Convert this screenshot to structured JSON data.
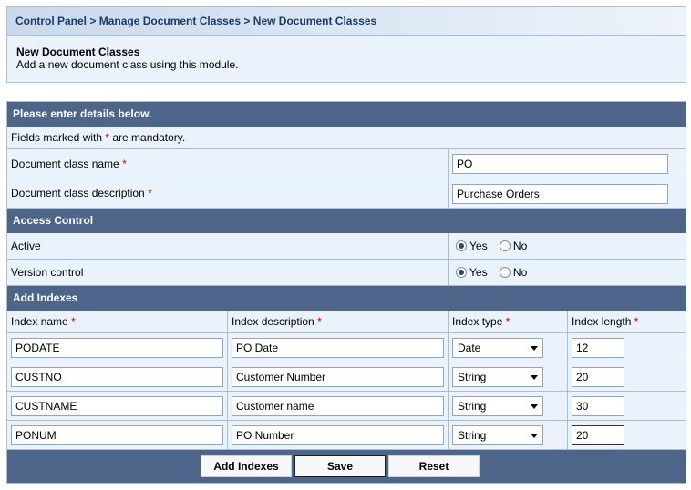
{
  "breadcrumb": {
    "part1": "Control Panel",
    "sep1": " > ",
    "part2": "Manage Document Classes",
    "sep2": " > ",
    "part3": "New Document Classes"
  },
  "page": {
    "title": "New Document Classes",
    "description": "Add a new document class using this module."
  },
  "form": {
    "header": "Please enter details below.",
    "mandatory_note_prefix": "Fields marked with ",
    "mandatory_star": "*",
    "mandatory_note_suffix": " are mandatory.",
    "class_name_label": "Document class name",
    "class_name_value": "PO",
    "class_desc_label": "Document class description",
    "class_desc_value": "Purchase Orders"
  },
  "access": {
    "header": "Access Control",
    "active_label": "Active",
    "version_label": "Version control",
    "yes": "Yes",
    "no": "No",
    "active_selected": "Yes",
    "version_selected": "Yes"
  },
  "indexes": {
    "header": "Add Indexes",
    "col_name": "Index name",
    "col_desc": "Index description",
    "col_type": "Index type",
    "col_length": "Index length",
    "rows": [
      {
        "name": "PODATE",
        "desc": "PO Date",
        "type": "Date",
        "length": "12"
      },
      {
        "name": "CUSTNO",
        "desc": "Customer Number",
        "type": "String",
        "length": "20"
      },
      {
        "name": "CUSTNAME",
        "desc": "Customer name",
        "type": "String",
        "length": "30"
      },
      {
        "name": "PONUM",
        "desc": "PO Number",
        "type": "String",
        "length": "20"
      }
    ]
  },
  "buttons": {
    "add_indexes": "Add Indexes",
    "save": "Save",
    "reset": "Reset"
  },
  "colors": {
    "section_header": "#4d6589",
    "panel_bg": "#eaf2fb",
    "border": "#a8bdd6",
    "required": "#cc0000"
  }
}
